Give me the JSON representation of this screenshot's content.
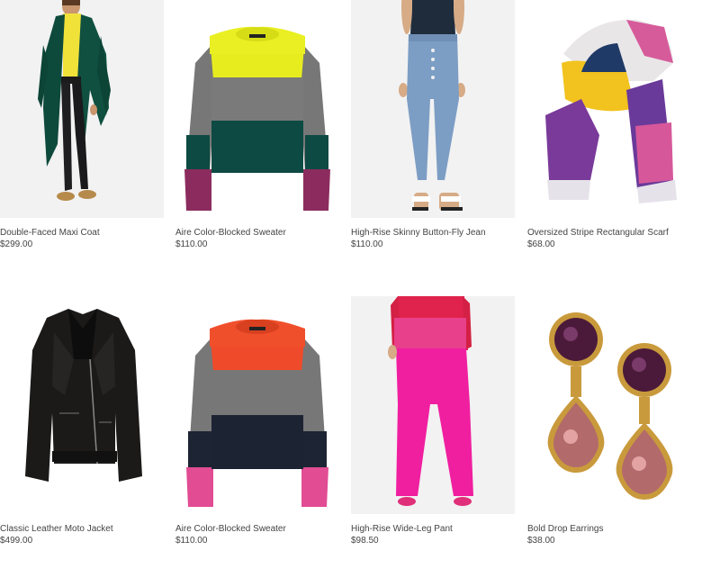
{
  "products": [
    {
      "name": "Double-Faced Maxi Coat",
      "price": "$299.00",
      "image": "green-maxi-coat"
    },
    {
      "name": "Aire Color-Blocked Sweater",
      "price": "$110.00",
      "image": "yellow-green-striped-sweater"
    },
    {
      "name": "High-Rise Skinny Button-Fly Jean",
      "price": "$110.00",
      "image": "light-wash-skinny-jean"
    },
    {
      "name": "Oversized Stripe Rectangular Scarf",
      "price": "$68.00",
      "image": "multicolor-stripe-scarf"
    },
    {
      "name": "Classic Leather Moto Jacket",
      "price": "$499.00",
      "image": "black-leather-moto-jacket"
    },
    {
      "name": "Aire Color-Blocked Sweater",
      "price": "$110.00",
      "image": "orange-navy-striped-sweater"
    },
    {
      "name": "High-Rise Wide-Leg Pant",
      "price": "$98.50",
      "image": "hot-pink-wide-leg-pant"
    },
    {
      "name": "Bold Drop Earrings",
      "price": "$38.00",
      "image": "purple-pink-drop-earrings"
    }
  ],
  "colors": {
    "image_bg": "#f1f1f1",
    "text": "#444444"
  }
}
